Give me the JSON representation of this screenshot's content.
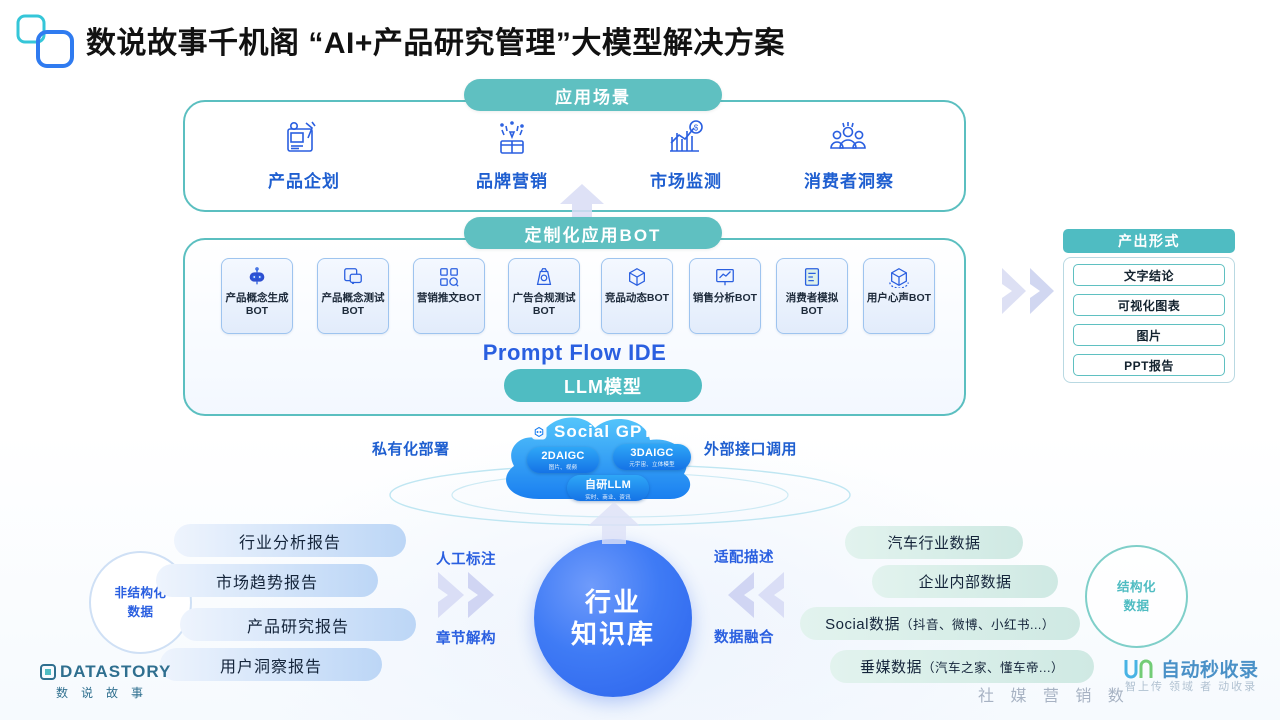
{
  "header": {
    "title": "数说故事千机阁  “AI+产品研究管理”大模型解决方案",
    "logo_icon": "squares-logo-icon"
  },
  "scenario_section": {
    "title": "应用场景",
    "items": [
      {
        "label": "产品企划",
        "icon": "product-planning-icon"
      },
      {
        "label": "品牌营销",
        "icon": "brand-marketing-icon"
      },
      {
        "label": "市场监测",
        "icon": "market-monitoring-icon"
      },
      {
        "label": "消费者洞察",
        "icon": "consumer-insight-icon"
      }
    ]
  },
  "bot_section": {
    "title": "定制化应用BOT",
    "cards": [
      {
        "label": "产品概念生成BOT",
        "icon": "robot-icon"
      },
      {
        "label": "产品概念测试BOT",
        "icon": "chat-test-icon"
      },
      {
        "label": "营销推文BOT",
        "icon": "grid-search-icon"
      },
      {
        "label": "广告合规测试BOT",
        "icon": "money-bag-icon"
      },
      {
        "label": "竞品动态BOT",
        "icon": "cube-icon"
      },
      {
        "label": "销售分析BOT",
        "icon": "chart-board-icon"
      },
      {
        "label": "消费者模拟BOT",
        "icon": "document-icon"
      },
      {
        "label": "用户心声BOT",
        "icon": "cube-rotate-icon"
      }
    ],
    "ide_label": "Prompt Flow IDE",
    "llm_label": "LLM模型"
  },
  "cloud": {
    "brand": "Social GPT",
    "brand_icon": "social-gpt-icon",
    "pills": [
      {
        "title": "2DAIGC",
        "sub": "图片、视频"
      },
      {
        "title": "3DAIGC",
        "sub": "元宇宙、立体模型"
      },
      {
        "title": "自研LLM",
        "sub": "实时、商业、资讯"
      }
    ],
    "left_label": "私有化部署",
    "right_label": "外部接口调用"
  },
  "output_section": {
    "title": "产出形式",
    "items": [
      "文字结论",
      "可视化图表",
      "图片",
      "PPT报告"
    ]
  },
  "data_section": {
    "unstructured_ring": "非结构化\n数据",
    "unstructured_ring_line1": "非结构化",
    "unstructured_ring_line2": "数据",
    "structured_ring_line1": "结构化",
    "structured_ring_line2": "数据",
    "reports": [
      "行业分析报告",
      "市场趋势报告",
      "产品研究报告",
      "用户洞察报告"
    ],
    "datasets": [
      {
        "main": "汽车行业数据",
        "sub": ""
      },
      {
        "main": "企业内部数据",
        "sub": ""
      },
      {
        "main": "Social数据",
        "sub": "（抖音、微博、小红书...）"
      },
      {
        "main": "垂媒数据",
        "sub": "（汽车之家、懂车帝...）"
      }
    ],
    "knowledge_line1": "行业",
    "knowledge_line2": "知识库",
    "flow_labels": {
      "annotate": "人工标注",
      "chapter": "章节解构",
      "adapt": "适配描述",
      "fusion": "数据融合"
    }
  },
  "footer": {
    "brand_en": "DATASTORY",
    "brand_cn": "数说故事",
    "watermark_cn": "社 媒 营 销 数",
    "watermark_brand": "自动秒收录",
    "watermark_sub": "智上传 领域 者 动收录"
  },
  "colors": {
    "teal": "#5fc0c1",
    "blue": "#2a5fe0",
    "ball_blue": "#3f7bf5",
    "title_black": "#111111"
  }
}
